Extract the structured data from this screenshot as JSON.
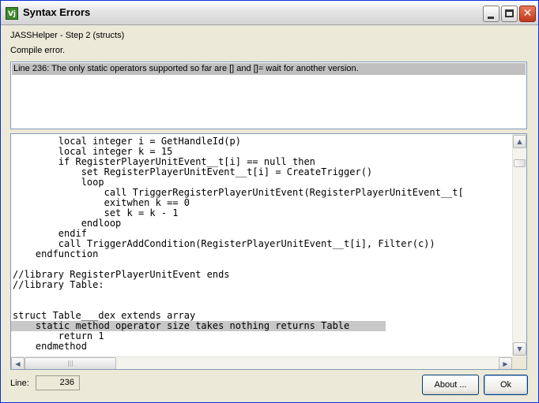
{
  "window": {
    "title": "Syntax Errors",
    "app_icon": "Vj",
    "controls": {
      "minimize": "minimize-icon",
      "maximize": "maximize-icon",
      "close": "close-icon"
    }
  },
  "header": {
    "step": "JASSHelper - Step 2 (structs)",
    "status": "Compile error."
  },
  "errors": [
    "Line 236: The only static operators supported so far are [] and []= wait for another version."
  ],
  "code_lines": [
    "        local integer i = GetHandleId(p)",
    "        local integer k = 15",
    "        if RegisterPlayerUnitEvent__t[i] == null then",
    "            set RegisterPlayerUnitEvent__t[i] = CreateTrigger()",
    "            loop",
    "                call TriggerRegisterPlayerUnitEvent(RegisterPlayerUnitEvent__t[",
    "                exitwhen k == 0",
    "                set k = k - 1",
    "            endloop",
    "        endif",
    "        call TriggerAddCondition(RegisterPlayerUnitEvent__t[i], Filter(c))",
    "    endfunction",
    "",
    "//library RegisterPlayerUnitEvent ends",
    "//library Table:",
    "",
    "",
    "struct Table___dex extends array",
    "    static method operator size takes nothing returns Table",
    "        return 1",
    "    endmethod"
  ],
  "highlighted_line_index": 18,
  "footer": {
    "line_label": "Line:",
    "line_value": "236",
    "about_label": "About ...",
    "ok_label": "Ok"
  },
  "colors": {
    "titlebar": "#e6e6e6",
    "highlight": "#c8c8c8",
    "border": "#7f9db9",
    "close_button": "#c2371b"
  }
}
